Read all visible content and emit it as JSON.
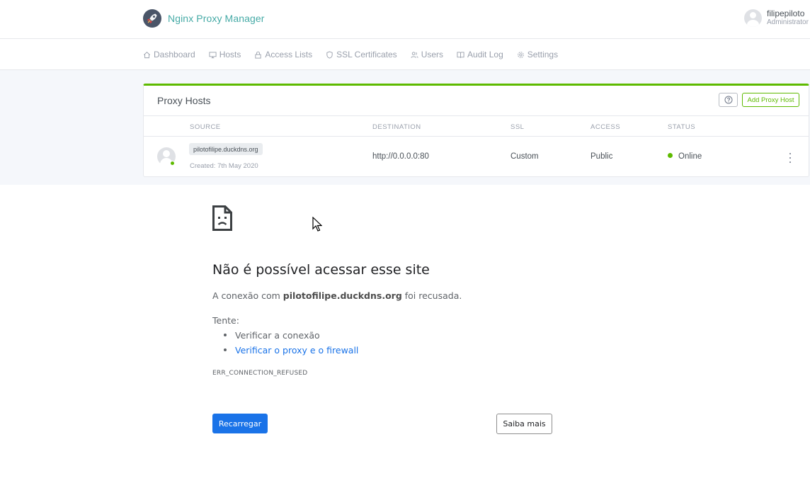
{
  "app": {
    "name": "Nginx Proxy Manager",
    "logo_icon": "rocket-icon"
  },
  "user": {
    "name": "filipepiloto",
    "role": "Administrator"
  },
  "nav": {
    "items": [
      {
        "label": "Dashboard",
        "icon": "home-icon"
      },
      {
        "label": "Hosts",
        "icon": "monitor-icon"
      },
      {
        "label": "Access Lists",
        "icon": "lock-icon"
      },
      {
        "label": "SSL Certificates",
        "icon": "shield-icon"
      },
      {
        "label": "Users",
        "icon": "users-icon"
      },
      {
        "label": "Audit Log",
        "icon": "book-icon"
      },
      {
        "label": "Settings",
        "icon": "gear-icon"
      }
    ]
  },
  "card": {
    "title": "Proxy Hosts",
    "help_icon": "help-circle-icon",
    "add_button": "Add Proxy Host",
    "accent_color": "#5eba00",
    "columns": [
      "SOURCE",
      "DESTINATION",
      "SSL",
      "ACCESS",
      "STATUS"
    ],
    "rows": [
      {
        "source": "pilotofilipe.duckdns.org",
        "created": "Created: 7th May 2020",
        "destination": "http://0.0.0.0:80",
        "ssl": "Custom",
        "access": "Public",
        "status": "Online",
        "status_color": "#5eba00"
      }
    ]
  },
  "error_page": {
    "icon": "sad-document-icon",
    "title": "Não é possível acessar esse site",
    "desc_prefix": "A conexão com ",
    "desc_host": "pilotofilipe.duckdns.org",
    "desc_suffix": " foi recusada.",
    "try_label": "Tente:",
    "suggestions": [
      {
        "text": "Verificar a conexão",
        "link": false
      },
      {
        "text": "Verificar o proxy e o firewall",
        "link": true
      }
    ],
    "error_code": "ERR_CONNECTION_REFUSED",
    "reload_button": "Recarregar",
    "more_button": "Saiba mais",
    "link_color": "#1a73e8"
  }
}
